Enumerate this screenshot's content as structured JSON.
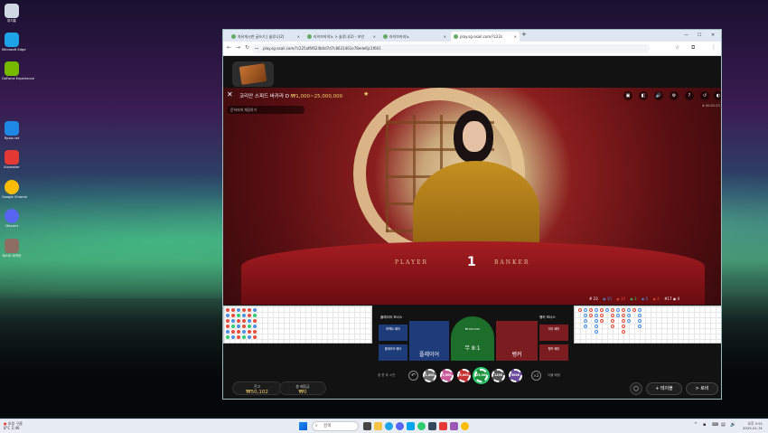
{
  "desktop": {
    "icons": [
      {
        "label": "휴지통",
        "color": "#cfd8e3"
      },
      {
        "label": "Microsoft Edge",
        "color": "#1fa3e8"
      },
      {
        "label": "GeForce Experience",
        "color": "#76b900"
      },
      {
        "label": "Ryzia.net",
        "color": "#1e88e5"
      },
      {
        "label": "Kusmater",
        "color": "#e53935"
      },
      {
        "label": "Google Chrome",
        "color": "#fbbc05"
      },
      {
        "label": "Discord",
        "color": "#5865f2"
      },
      {
        "label": "테스트 바카라",
        "color": "#8d6e63"
      }
    ]
  },
  "browser": {
    "tabs": [
      {
        "label": "자유게시판 글쓰기 | 솔루나(2)"
      },
      {
        "label": "라이브카지노 > 솔루나(2) - 보안"
      },
      {
        "label": "라이브카지노"
      },
      {
        "label": "play.sg-asail.com/?c22s"
      }
    ],
    "new_tab": "+",
    "window_controls": {
      "min": "—",
      "max": "☐",
      "close": "✕"
    },
    "url": "play.sg-asail.com/?c225af6f624b0d7d7c8631461e78ede6jc1f601",
    "nav": {
      "back": "←",
      "forward": "→",
      "reload": "↻",
      "secure": "⊶"
    }
  },
  "game": {
    "table_title": "코리안 스피드 바카라 D",
    "limits": "₩1,000~25,000,000",
    "chat_placeholder": "운하러에 채팅하기",
    "timecode": "# 00:01:23",
    "table_labels": {
      "player": "PLAYER",
      "banker": "BANKER"
    },
    "round_number": "1",
    "controls": [
      "▣",
      "◧",
      "🔊",
      "⚙",
      "?",
      "↺",
      "◐"
    ],
    "stats": [
      "# 23",
      "◉ 10",
      "◉ 10",
      "◉ 3",
      "◉ 5",
      "◉ 4",
      "#17 ◉ 4"
    ],
    "bet_zones": {
      "player_bonus": "플레이어 보너스",
      "banker_bonus": "뱅커 보너스",
      "player_pair": "퍼펙트 페어",
      "banker_pair": "퍼펙트 페어",
      "either_pair": "이티 페어",
      "player_pair_2": "플레이어 페어",
      "banker_pair_2": "뱅커 페어",
      "player": "플레이어",
      "tie": "무 8:1",
      "banker": "뱅커",
      "tie_mini": "₩ 000 000"
    },
    "chips": {
      "label": "칩 한 후 시간",
      "values": [
        "1,000",
        "2,500",
        "5,000",
        "25,000",
        "125K",
        "500K"
      ],
      "colors": [
        "#6b6b6b",
        "#c85a9a",
        "#c53030",
        "#1e8f3c",
        "#555",
        "#6a4a9a"
      ],
      "selected_index": 3,
      "undo": "↶",
      "double": "×2",
      "more": "더블 베팅"
    },
    "balance": {
      "label": "잔고",
      "amount": "₩50,102"
    },
    "total_bet": {
      "label": "총 베팅금",
      "amount": "₩0"
    },
    "buttons": {
      "chat": "◯",
      "tables": "+ 테이블",
      "lobby": "> 로비"
    }
  },
  "taskbar": {
    "weather": "흐림 구름",
    "weather_sub": "8°C 1:46",
    "search_placeholder": "검색",
    "clock_time": "오후 3:51",
    "clock_date": "2025-01-31"
  }
}
